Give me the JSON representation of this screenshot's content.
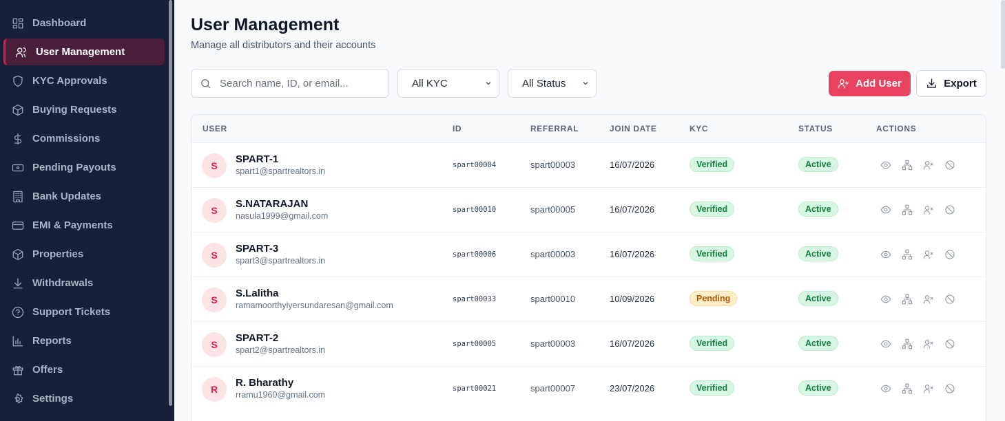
{
  "sidebar": {
    "items": [
      {
        "label": "Dashboard",
        "icon": "dashboard-icon",
        "active": false
      },
      {
        "label": "User Management",
        "icon": "users-icon",
        "active": true
      },
      {
        "label": "KYC Approvals",
        "icon": "shield-icon",
        "active": false
      },
      {
        "label": "Buying Requests",
        "icon": "package-icon",
        "active": false
      },
      {
        "label": "Commissions",
        "icon": "dollar-icon",
        "active": false
      },
      {
        "label": "Pending Payouts",
        "icon": "banknote-icon",
        "active": false
      },
      {
        "label": "Bank Updates",
        "icon": "building-icon",
        "active": false
      },
      {
        "label": "EMI & Payments",
        "icon": "credit-card-icon",
        "active": false
      },
      {
        "label": "Properties",
        "icon": "box-icon",
        "active": false
      },
      {
        "label": "Withdrawals",
        "icon": "download-icon",
        "active": false
      },
      {
        "label": "Support Tickets",
        "icon": "help-circle-icon",
        "active": false
      },
      {
        "label": "Reports",
        "icon": "bar-chart-icon",
        "active": false
      },
      {
        "label": "Offers",
        "icon": "gift-icon",
        "active": false
      },
      {
        "label": "Settings",
        "icon": "gear-icon",
        "active": false
      }
    ]
  },
  "header": {
    "title": "User Management",
    "subtitle": "Manage all distributors and their accounts"
  },
  "toolbar": {
    "search_placeholder": "Search name, ID, or email...",
    "kyc_filter": "All KYC",
    "status_filter": "All Status",
    "add_label": "Add User",
    "export_label": "Export"
  },
  "table": {
    "columns": [
      "USER",
      "ID",
      "REFERRAL",
      "JOIN DATE",
      "KYC",
      "STATUS",
      "ACTIONS"
    ],
    "rows": [
      {
        "initial": "S",
        "name": "SPART-1",
        "email": "spart1@spartrealtors.in",
        "id": "spart00004",
        "referral": "spart00003",
        "join_date": "16/07/2026",
        "kyc": "Verified",
        "status": "Active"
      },
      {
        "initial": "S",
        "name": "S.NATARAJAN",
        "email": "nasula1999@gmail.com",
        "id": "spart00010",
        "referral": "spart00005",
        "join_date": "16/07/2026",
        "kyc": "Verified",
        "status": "Active"
      },
      {
        "initial": "S",
        "name": "SPART-3",
        "email": "spart3@spartrealtors.in",
        "id": "spart00006",
        "referral": "spart00003",
        "join_date": "16/07/2026",
        "kyc": "Verified",
        "status": "Active"
      },
      {
        "initial": "S",
        "name": "S.Lalitha",
        "email": "ramamoorthyiyersundaresan@gmail.com",
        "id": "spart00033",
        "referral": "spart00010",
        "join_date": "10/09/2026",
        "kyc": "Pending",
        "status": "Active"
      },
      {
        "initial": "S",
        "name": "SPART-2",
        "email": "spart2@spartrealtors.in",
        "id": "spart00005",
        "referral": "spart00003",
        "join_date": "16/07/2026",
        "kyc": "Verified",
        "status": "Active"
      },
      {
        "initial": "R",
        "name": "R. Bharathy",
        "email": "rramu1960@gmail.com",
        "id": "spart00021",
        "referral": "spart00007",
        "join_date": "23/07/2026",
        "kyc": "Verified",
        "status": "Active"
      }
    ]
  }
}
